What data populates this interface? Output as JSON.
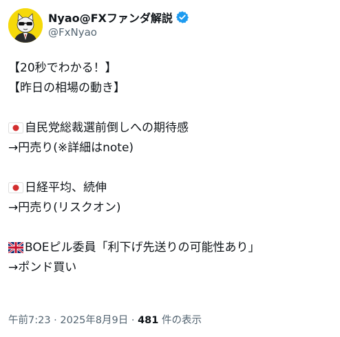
{
  "author": {
    "display_name": "Nyao@FXファンダ解説",
    "handle": "@FxNyao",
    "avatar_icon": "cat-avatar-icon",
    "verified_icon": "verified-badge-icon",
    "verified_color": "#1d9bf0"
  },
  "tweet": {
    "line1": "【20秒でわかる！】",
    "line2": "【昨日の相場の動き】",
    "item1_flag": "japan-flag-icon",
    "item1_title": "自民党総裁選前倒しへの期待感",
    "item1_result": "→円売り(※詳細はnote)",
    "item2_flag": "japan-flag-icon",
    "item2_title": "日経平均、続伸",
    "item2_result": "→円売り(リスクオン)",
    "item3_flag": "uk-flag-icon",
    "item3_title": "BOEピル委員「利下げ先送りの可能性あり」",
    "item3_result": "→ポンド買い"
  },
  "meta": {
    "time": "午前7:23",
    "separator": " · ",
    "date": "2025年8月9日",
    "views_count": "481",
    "views_label": " 件の表示"
  }
}
